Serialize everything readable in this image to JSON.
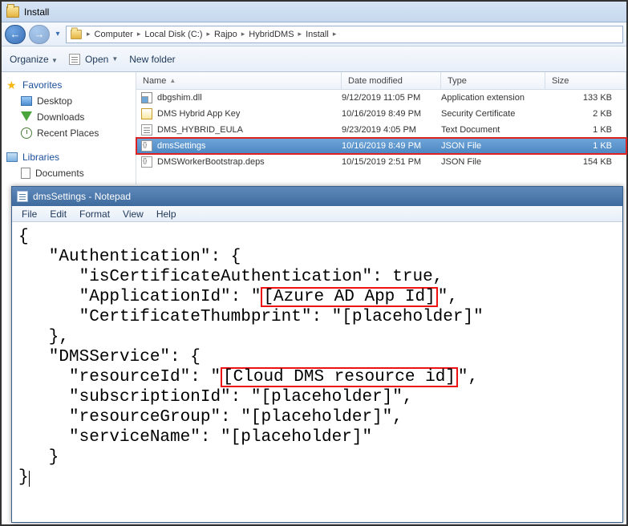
{
  "explorer": {
    "title": "Install",
    "breadcrumb": [
      "Computer",
      "Local Disk (C:)",
      "Rajpo",
      "HybridDMS",
      "Install"
    ],
    "organize": "Organize",
    "open": "Open",
    "newfolder": "New folder",
    "nav": {
      "favorites": "Favorites",
      "desktop": "Desktop",
      "downloads": "Downloads",
      "recent": "Recent Places",
      "libraries": "Libraries",
      "documents": "Documents"
    },
    "headers": {
      "name": "Name",
      "date": "Date modified",
      "type": "Type",
      "size": "Size"
    },
    "files": [
      {
        "name": "dbgshim.dll",
        "date": "9/12/2019 11:05 PM",
        "type": "Application extension",
        "size": "133 KB",
        "icon": "dll"
      },
      {
        "name": "DMS Hybrid App Key",
        "date": "10/16/2019 8:49 PM",
        "type": "Security Certificate",
        "size": "2 KB",
        "icon": "cert"
      },
      {
        "name": "DMS_HYBRID_EULA",
        "date": "9/23/2019 4:05 PM",
        "type": "Text Document",
        "size": "1 KB",
        "icon": "txt"
      },
      {
        "name": "dmsSettings",
        "date": "10/16/2019 8:49 PM",
        "type": "JSON File",
        "size": "1 KB",
        "icon": "json",
        "selected": true
      },
      {
        "name": "DMSWorkerBootstrap.deps",
        "date": "10/15/2019 2:51 PM",
        "type": "JSON File",
        "size": "154 KB",
        "icon": "json"
      }
    ]
  },
  "notepad": {
    "title": "dmsSettings - Notepad",
    "menu": [
      "File",
      "Edit",
      "Format",
      "View",
      "Help"
    ],
    "content": {
      "l1": "{",
      "l2": "   \"Authentication\": {",
      "l3a": "      \"isCertificateAuthentication\": true,",
      "l4a": "      \"ApplicationId\": \"",
      "l4h": "[Azure AD App Id]",
      "l4b": "\",",
      "l5": "      \"CertificateThumbprint\": \"[placeholder]\"",
      "l6": "   },",
      "l7": "   \"DMSService\": {",
      "l8a": "     \"resourceId\": \"",
      "l8h": "[Cloud DMS resource id]",
      "l8b": "\",",
      "l9": "     \"subscriptionId\": \"[placeholder]\",",
      "l10": "     \"resourceGroup\": \"[placeholder]\",",
      "l11": "     \"serviceName\": \"[placeholder]\"",
      "l12": "   }",
      "l13": "}"
    }
  }
}
